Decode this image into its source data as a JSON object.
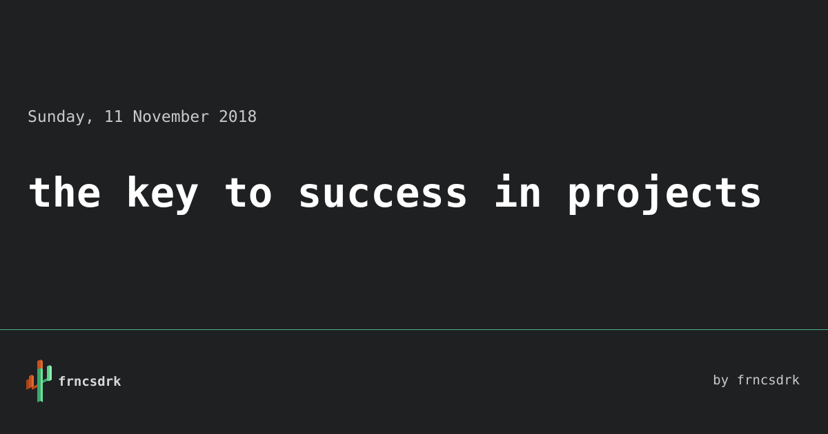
{
  "post": {
    "date": "Sunday, 11 November 2018",
    "title": "the key to success in projects"
  },
  "footer": {
    "brand_name": "frncsdrk",
    "byline": "by frncsdrk",
    "logo_icon": "cactus-logo-icon"
  },
  "colors": {
    "background": "#1f2022",
    "divider": "#4bb583",
    "logo_green": "#5fd38d",
    "logo_orange": "#d8602a"
  }
}
